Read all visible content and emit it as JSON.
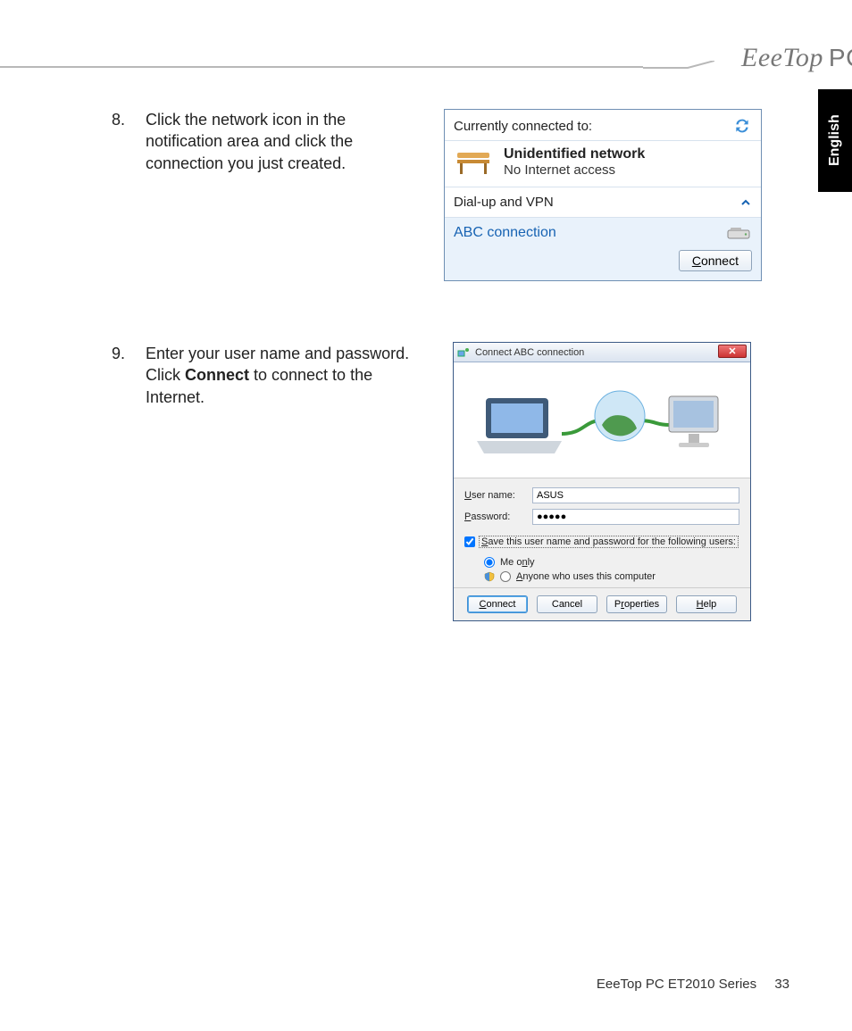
{
  "brand": {
    "name": "EeeTop",
    "suffix": "PC"
  },
  "lang_tab": "English",
  "steps": {
    "s8": {
      "num": "8.",
      "text": "Click the network icon in the notification area and click the connection you just created."
    },
    "s9": {
      "num": "9.",
      "text_pre": "Enter your user name and password. Click ",
      "bold": "Connect",
      "text_post": " to connect to the Internet."
    }
  },
  "popup1": {
    "title": "Currently connected to:",
    "net_name": "Unidentified network",
    "net_status": "No Internet access",
    "section": "Dial-up and VPN",
    "conn_name": "ABC connection",
    "connect_btn": "Connect"
  },
  "dialog": {
    "title": "Connect ABC connection",
    "username_label": "User name:",
    "username_value": "ASUS",
    "password_label": "Password:",
    "password_value": "●●●●●",
    "save_chk": "Save this user name and password for the following users:",
    "radio_me": "Me only",
    "radio_anyone": "Anyone who uses this computer",
    "btn_connect": "Connect",
    "btn_cancel": "Cancel",
    "btn_properties": "Properties",
    "btn_help": "Help"
  },
  "footer": {
    "series": "EeeTop PC ET2010 Series",
    "page": "33"
  }
}
